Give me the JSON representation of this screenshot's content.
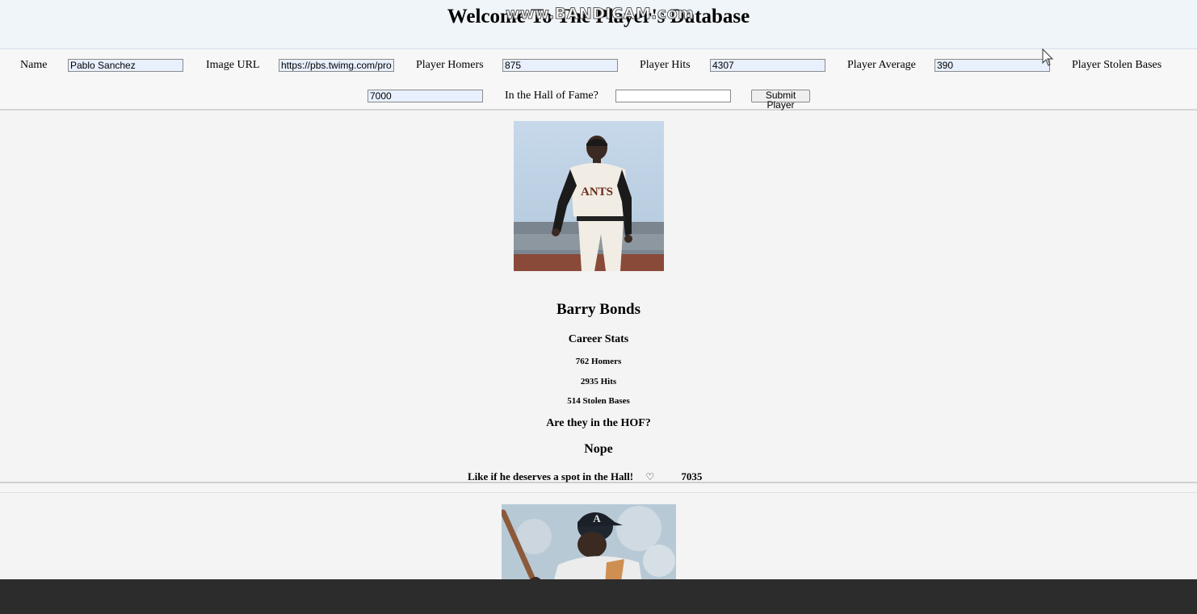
{
  "header": {
    "title": "Welcome To The Player's Database",
    "watermark": "www.BANDICAM.com"
  },
  "form": {
    "name_label": "Name",
    "name_value": "Pablo Sanchez",
    "image_label": "Image URL",
    "image_value": "https://pbs.twimg.com/profile",
    "homers_label": "Player Homers",
    "homers_value": "875",
    "hits_label": "Player Hits",
    "hits_value": "4307",
    "average_label": "Player Average",
    "average_value": "390",
    "stolen_label": "Player Stolen Bases",
    "stolen_value": "7000",
    "hof_label": "In the Hall of Fame?",
    "hof_value": "",
    "submit_label": "Submit Player"
  },
  "players": [
    {
      "name": "Barry Bonds",
      "stats_title": "Career Stats",
      "homers": "762 Homers",
      "hits": "2935 Hits",
      "stolen": "514 Stolen Bases",
      "hof_question": "Are they in the HOF?",
      "hof_answer": "Nope",
      "like_text": "Like if he deserves a spot in the Hall!",
      "like_icon": "heart-icon",
      "likes": "7035"
    }
  ],
  "colors": {
    "header_bg": "#f0f5fa",
    "autofill_bg": "#e8f0fe",
    "taskbar": "#2c2c2c"
  }
}
